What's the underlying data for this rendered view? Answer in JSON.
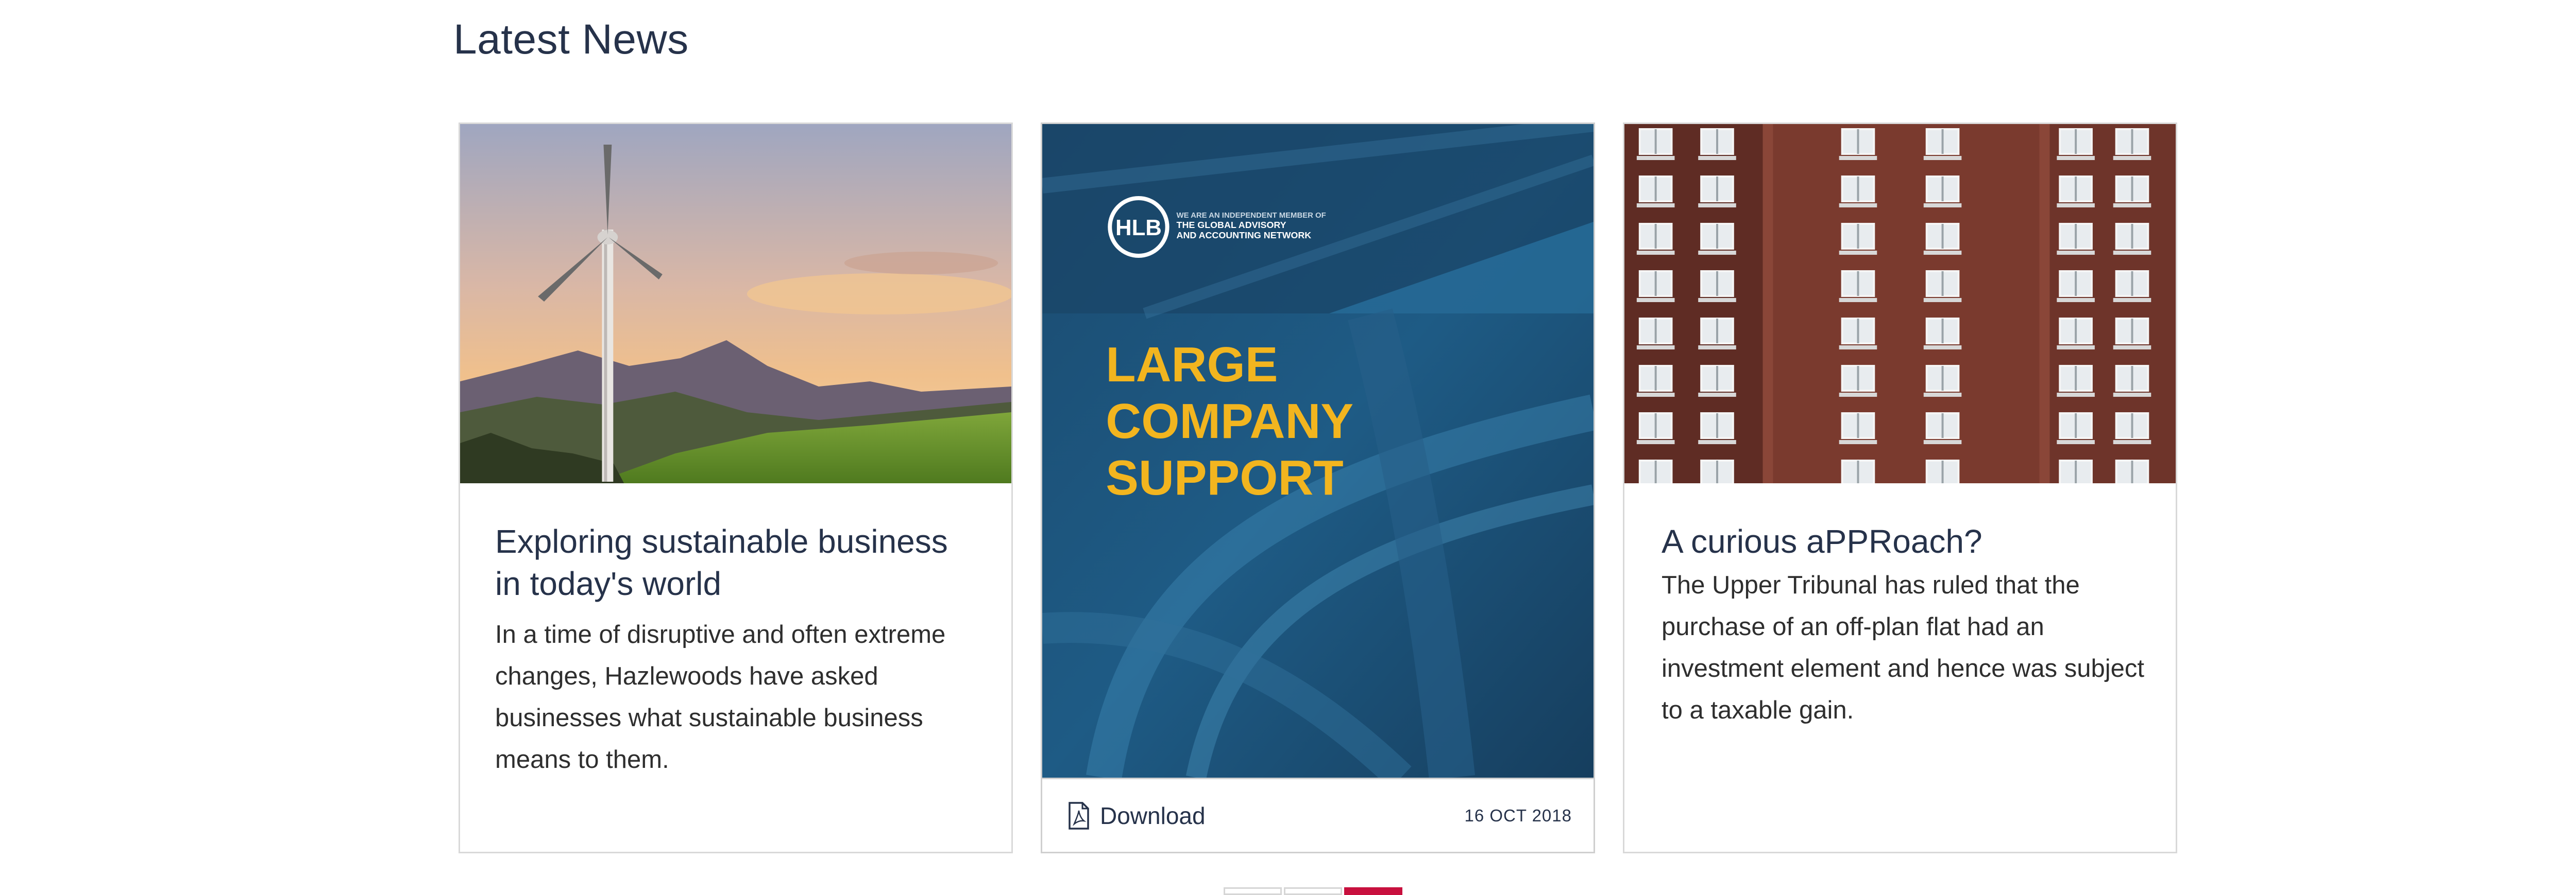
{
  "section": {
    "title": "Latest News"
  },
  "cards": [
    {
      "title": "Exploring sustainable business in today's world",
      "text": "In a time of disruptive and often extreme changes, Hazlewoods have asked businesses what sustainable business means to them.",
      "image_icon": "wind-turbine-landscape"
    },
    {
      "cover": {
        "logo": "HLB",
        "tagline_1": "WE ARE AN INDEPENDENT MEMBER OF",
        "tagline_2": "THE GLOBAL ADVISORY",
        "tagline_3": "AND ACCOUNTING NETWORK",
        "headline_1": "LARGE",
        "headline_2": "COMPANY",
        "headline_3": "SUPPORT"
      },
      "download_label": "Download",
      "download_icon": "pdf-icon",
      "date": "16 OCT 2018"
    },
    {
      "title": "A curious aPPRoach?",
      "text": "The Upper Tribunal has ruled that the purchase of an off-plan flat had an investment element and hence was subject to a taxable gain.",
      "image_icon": "brick-apartment-building"
    }
  ],
  "pager": {
    "pages": 3,
    "active": 3,
    "accent": "#c8103e"
  },
  "colors": {
    "heading": "#26324a",
    "accent": "#c8103e",
    "cover_blue": "#1d5d86",
    "cover_yellow": "#f2b51f"
  }
}
